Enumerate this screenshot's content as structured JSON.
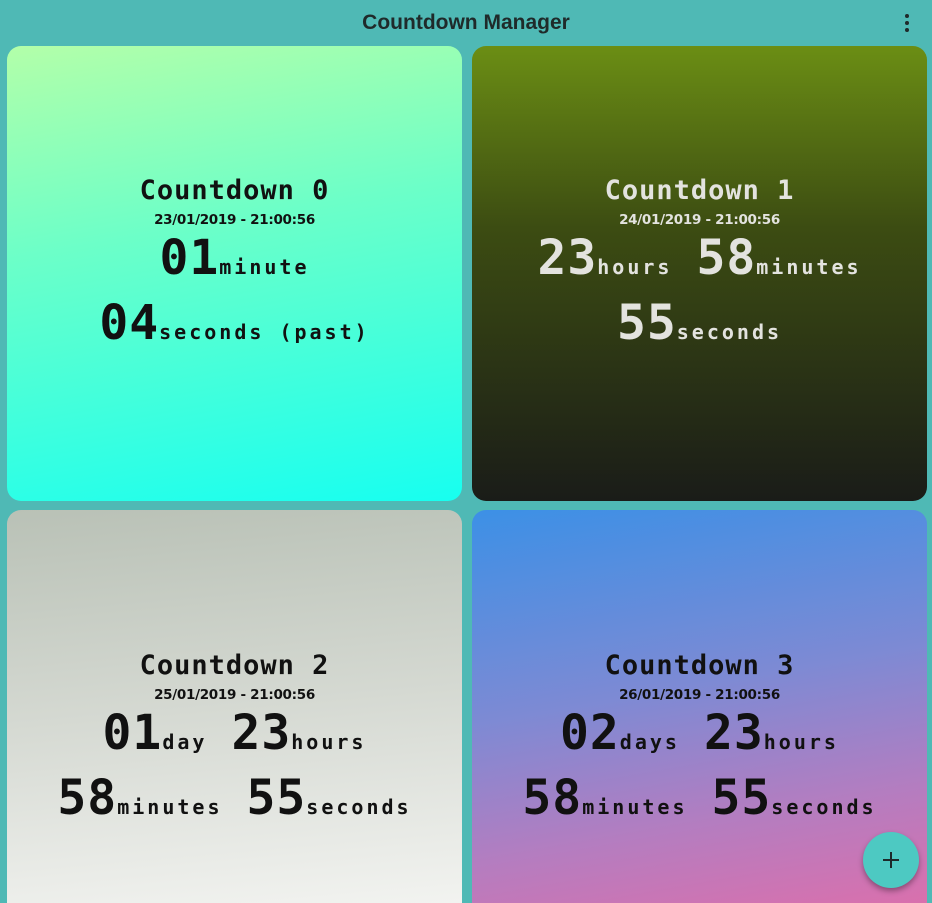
{
  "app": {
    "title": "Countdown Manager"
  },
  "icons": {
    "menu": "more-vert-icon",
    "add": "plus-icon"
  },
  "cards": [
    {
      "name": "Countdown 0",
      "date": "23/01/2019 - 21:00:56",
      "rows": [
        [
          {
            "num": "01",
            "unit": "minute"
          }
        ],
        [
          {
            "num": "04",
            "unit": "seconds (past)"
          }
        ]
      ]
    },
    {
      "name": "Countdown 1",
      "date": "24/01/2019 - 21:00:56",
      "rows": [
        [
          {
            "num": "23",
            "unit": "hours"
          },
          {
            "num": "58",
            "unit": "minutes"
          }
        ],
        [
          {
            "num": "55",
            "unit": "seconds"
          }
        ]
      ]
    },
    {
      "name": "Countdown 2",
      "date": "25/01/2019 - 21:00:56",
      "rows": [
        [
          {
            "num": "01",
            "unit": "day"
          },
          {
            "num": "23",
            "unit": "hours"
          }
        ],
        [
          {
            "num": "58",
            "unit": "minutes"
          },
          {
            "num": "55",
            "unit": "seconds"
          }
        ]
      ]
    },
    {
      "name": "Countdown 3",
      "date": "26/01/2019 - 21:00:56",
      "rows": [
        [
          {
            "num": "02",
            "unit": "days"
          },
          {
            "num": "23",
            "unit": "hours"
          }
        ],
        [
          {
            "num": "58",
            "unit": "minutes"
          },
          {
            "num": "55",
            "unit": "seconds"
          }
        ]
      ]
    }
  ]
}
